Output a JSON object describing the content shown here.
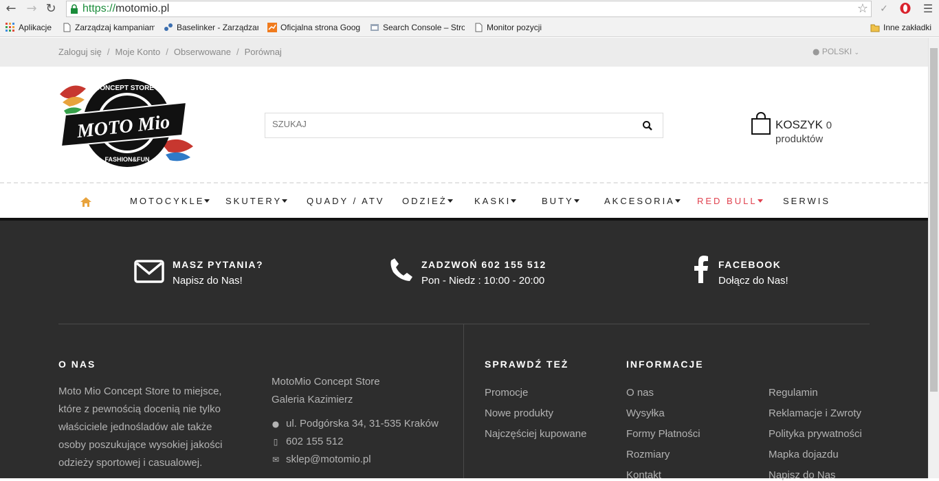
{
  "browser": {
    "url_scheme": "https://",
    "url_host": "motomio.pl",
    "bookmarks": [
      {
        "label": "Aplikacje"
      },
      {
        "label": "Zarządzaj kampaniam"
      },
      {
        "label": "Baselinker - Zarządzar"
      },
      {
        "label": "Oficjalna strona Goog"
      },
      {
        "label": "Search Console – Stro"
      },
      {
        "label": "Monitor pozycji"
      }
    ],
    "other_bookmarks": "Inne zakładki"
  },
  "topbar": {
    "links": [
      "Zaloguj się",
      "Moje Konto",
      "Obserwowane",
      "Porównaj"
    ],
    "separator": "/",
    "language": "POLSKI"
  },
  "header": {
    "search_placeholder": "SZUKAJ",
    "cart_label": "KOSZYK",
    "cart_count": "0 produktów",
    "logo_text_top": "CONCEPT STORE",
    "logo_text_main": "MOTO Mio",
    "logo_text_bottom": "FASHION&FUN"
  },
  "menu": {
    "items": [
      {
        "label": "MOTOCYKLE"
      },
      {
        "label": "SKUTERY"
      },
      {
        "label": "QUADY / ATV"
      },
      {
        "label": "ODZIEŻ"
      },
      {
        "label": "KASKI"
      },
      {
        "label": "BUTY"
      },
      {
        "label": "AKCESORIA"
      },
      {
        "label": "RED BULL"
      },
      {
        "label": "SERWIS"
      }
    ]
  },
  "contact": {
    "questions_title": "MASZ PYTANIA?",
    "questions_sub": "Napisz do Nas!",
    "phone_title": "ZADZWOŃ 602 155 512",
    "phone_sub": "Pon - Niedz : 10:00 - 20:00",
    "facebook_title": "FACEBOOK",
    "facebook_sub": "Dołącz do Nas!"
  },
  "footer": {
    "about_title": "O NAS",
    "about_text": "Moto Mio Concept Store to miejsce, które z pewnością docenią nie tylko właściciele jednośladów ale także osoby poszukujące wysokiej jakości odzieży sportowej i casualowej.",
    "store_name": "MotoMio Concept Store",
    "store_place": "Galeria Kazimierz",
    "address": "ul. Podgórska 34, 31-535 Kraków",
    "phone": "602 155 512",
    "email": "sklep@motomio.pl",
    "check_title": "SPRAWDŹ TEŻ",
    "check_links": [
      "Promocje",
      "Nowe produkty",
      "Najczęściej kupowane"
    ],
    "info_title": "INFORMACJE",
    "info_links_a": [
      "O nas",
      "Wysyłka",
      "Formy Płatności",
      "Rozmiary",
      "Kontakt"
    ],
    "info_links_b": [
      "Regulamin",
      "Reklamacje i Zwroty",
      "Polityka prywatności",
      "Mapka dojazdu",
      "Napisz do Nas"
    ]
  },
  "colors": {
    "accent_red": "#e0414e",
    "home_icon": "#e8a33d",
    "footer_bg": "#2d2d2d"
  }
}
